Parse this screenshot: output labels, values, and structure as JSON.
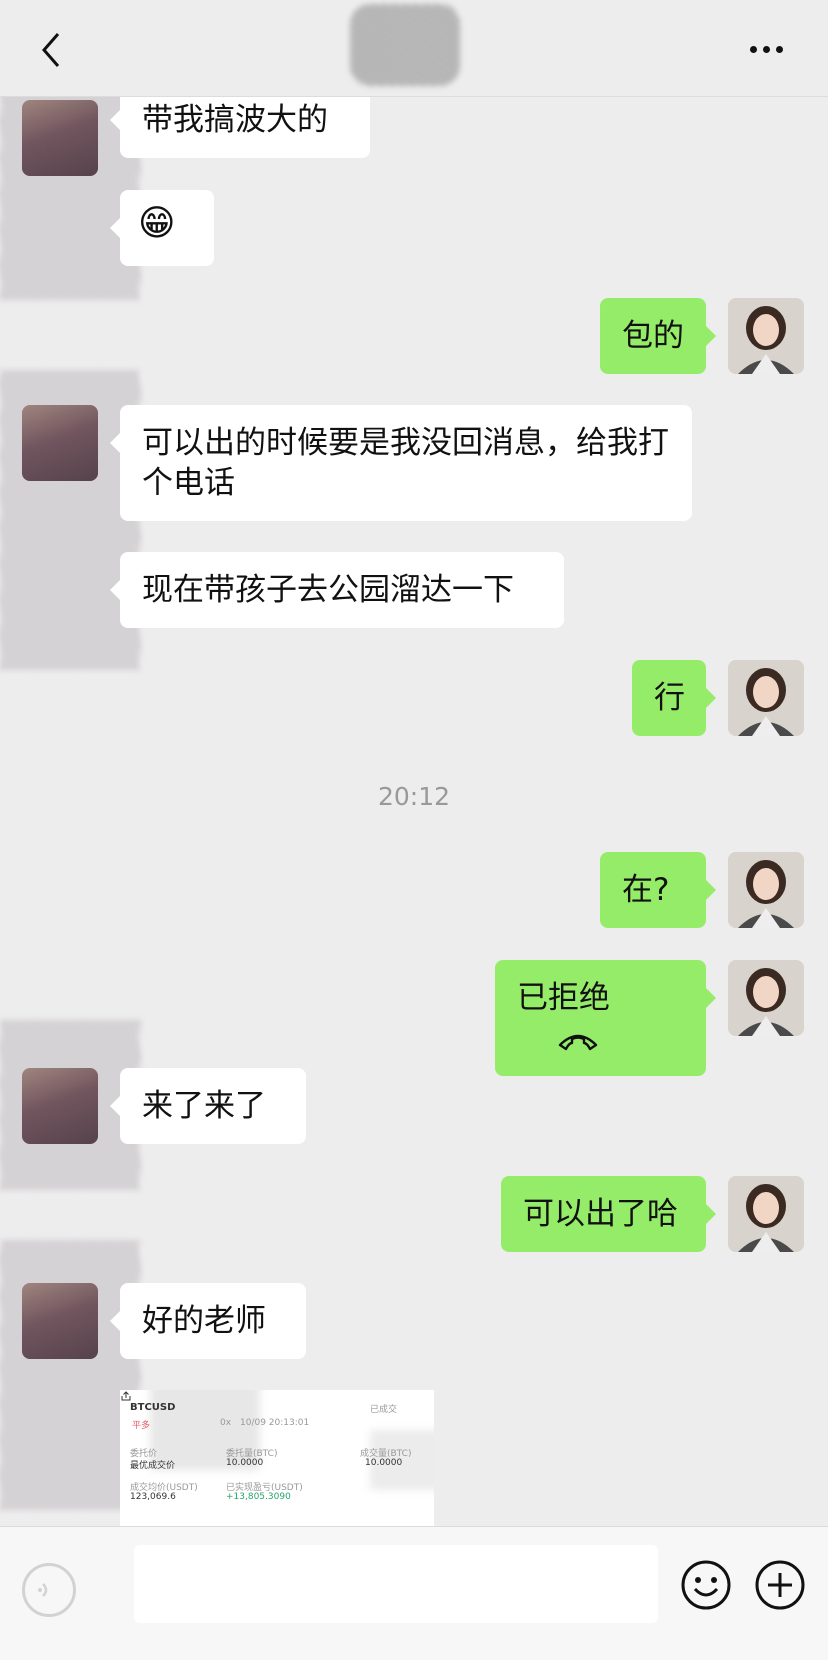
{
  "header": {
    "back_icon": "chevron-left-icon",
    "more_icon": "more-horizontal-icon"
  },
  "messages": [
    {
      "side": "left",
      "text": "带我搞波大的"
    },
    {
      "side": "left",
      "emoji": "😁"
    },
    {
      "side": "right",
      "text": "包的"
    },
    {
      "side": "left",
      "text": "可以出的时候要是我没回消息，给我打个电话"
    },
    {
      "side": "left",
      "text": "现在带孩子去公园溜达一下"
    },
    {
      "side": "right",
      "text": "行"
    },
    {
      "side": "right",
      "text": "在?"
    },
    {
      "side": "right",
      "text": "已拒绝",
      "icon": "declined-call-icon"
    },
    {
      "side": "left",
      "text": "来了来了"
    },
    {
      "side": "right",
      "text": "可以出了哈"
    },
    {
      "side": "left",
      "text": "好的老师"
    }
  ],
  "timestamp": "20:12",
  "trade_card": {
    "symbol": "BTCUSD",
    "status": "已成交",
    "side": "平多",
    "leverage": "0x",
    "time": "10/09 20:13:01",
    "order_price_label": "委托价",
    "order_price": "最优成交价",
    "order_qty_label": "委托量(BTC)",
    "order_qty": "10.0000",
    "filled_qty_label": "成交量(BTC)",
    "filled_qty": "10.0000",
    "avg_price_label": "成交均价(USDT)",
    "avg_price": "123,069.6",
    "pnl_label": "已实现盈亏(USDT)",
    "pnl": "+13,805.3090"
  },
  "footer": {
    "voice_icon": "voice-icon",
    "emoji_icon": "emoji-icon",
    "plus_icon": "plus-icon"
  },
  "colors": {
    "sent_bubble": "#95ec69",
    "received_bubble": "#ffffff",
    "background": "#ededed",
    "profit": "#25a56a"
  }
}
